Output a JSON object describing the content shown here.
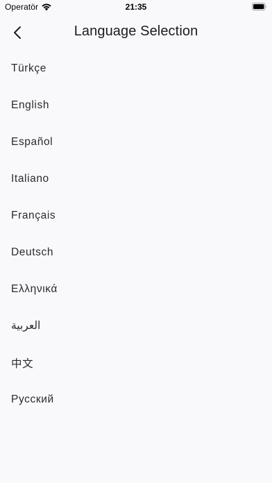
{
  "status_bar": {
    "carrier": "Operatör",
    "time": "21:35",
    "wifi_icon": "wifi-icon",
    "battery_icon": "battery-icon"
  },
  "nav": {
    "back_icon": "chevron-left-icon",
    "title": "Language Selection"
  },
  "languages": [
    {
      "label": "Türkçe"
    },
    {
      "label": "English"
    },
    {
      "label": "Español"
    },
    {
      "label": "Italiano"
    },
    {
      "label": "Français"
    },
    {
      "label": "Deutsch"
    },
    {
      "label": "Ελληνικά"
    },
    {
      "label": "العربية"
    },
    {
      "label": "中文"
    },
    {
      "label": "Русский"
    }
  ],
  "colors": {
    "background": "#f9f9fb",
    "text": "#1c1c1e"
  }
}
